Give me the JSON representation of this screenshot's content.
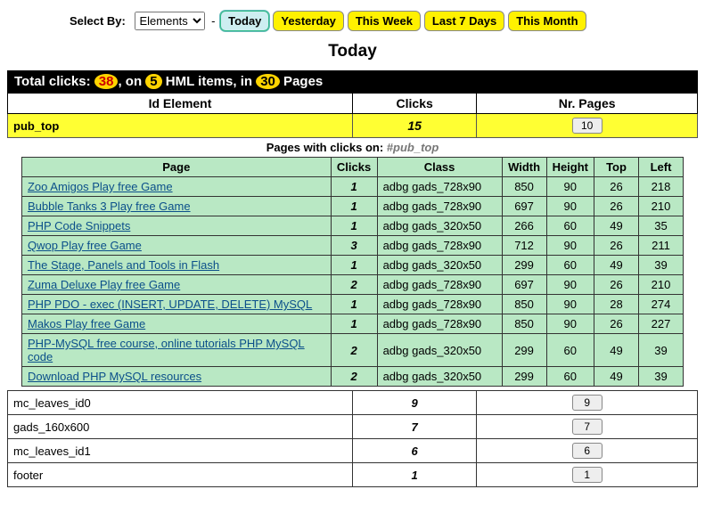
{
  "filter": {
    "label": "Select By:",
    "select_value": "Elements",
    "dash": "-",
    "ranges": [
      "Today",
      "Yesterday",
      "This Week",
      "Last 7 Days",
      "This Month"
    ],
    "active_index": 0
  },
  "heading": "Today",
  "totals": {
    "prefix": "Total clicks: ",
    "clicks": "38",
    "mid1": ", on ",
    "items": "5",
    "mid2": " HML items, in ",
    "pages": "30",
    "suffix": " Pages"
  },
  "outer_headers": {
    "id": "Id Element",
    "clicks": "Clicks",
    "pages": "Nr. Pages"
  },
  "yellow": {
    "id": "pub_top",
    "clicks": "15",
    "pages": "10"
  },
  "sub_caption": {
    "prefix": "Pages with clicks on: ",
    "target": "#pub_top"
  },
  "inner_headers": {
    "page": "Page",
    "clicks": "Clicks",
    "class": "Class",
    "width": "Width",
    "height": "Height",
    "top": "Top",
    "left": "Left"
  },
  "pages_detail": [
    {
      "page": "Zoo Amigos Play free Game",
      "clicks": "1",
      "class": "adbg gads_728x90",
      "w": "850",
      "h": "90",
      "t": "26",
      "l": "218"
    },
    {
      "page": "Bubble Tanks 3 Play free Game",
      "clicks": "1",
      "class": "adbg gads_728x90",
      "w": "697",
      "h": "90",
      "t": "26",
      "l": "210"
    },
    {
      "page": "PHP Code Snippets",
      "clicks": "1",
      "class": "adbg gads_320x50",
      "w": "266",
      "h": "60",
      "t": "49",
      "l": "35"
    },
    {
      "page": "Qwop Play free Game",
      "clicks": "3",
      "class": "adbg gads_728x90",
      "w": "712",
      "h": "90",
      "t": "26",
      "l": "211"
    },
    {
      "page": "The Stage, Panels and Tools in Flash",
      "clicks": "1",
      "class": "adbg gads_320x50",
      "w": "299",
      "h": "60",
      "t": "49",
      "l": "39"
    },
    {
      "page": "Zuma Deluxe Play free Game",
      "clicks": "2",
      "class": "adbg gads_728x90",
      "w": "697",
      "h": "90",
      "t": "26",
      "l": "210"
    },
    {
      "page": "PHP PDO - exec (INSERT, UPDATE, DELETE) MySQL",
      "clicks": "1",
      "class": "adbg gads_728x90",
      "w": "850",
      "h": "90",
      "t": "28",
      "l": "274"
    },
    {
      "page": "Makos Play free Game",
      "clicks": "1",
      "class": "adbg gads_728x90",
      "w": "850",
      "h": "90",
      "t": "26",
      "l": "227"
    },
    {
      "page": "PHP-MySQL free course, online tutorials PHP MySQL code",
      "clicks": "2",
      "class": "adbg gads_320x50",
      "w": "299",
      "h": "60",
      "t": "49",
      "l": "39"
    },
    {
      "page": "Download PHP MySQL resources",
      "clicks": "2",
      "class": "adbg gads_320x50",
      "w": "299",
      "h": "60",
      "t": "49",
      "l": "39"
    }
  ],
  "elements": [
    {
      "id": "mc_leaves_id0",
      "clicks": "9",
      "pages": "9"
    },
    {
      "id": "gads_160x600",
      "clicks": "7",
      "pages": "7"
    },
    {
      "id": "mc_leaves_id1",
      "clicks": "6",
      "pages": "6"
    },
    {
      "id": "footer",
      "clicks": "1",
      "pages": "1"
    }
  ]
}
